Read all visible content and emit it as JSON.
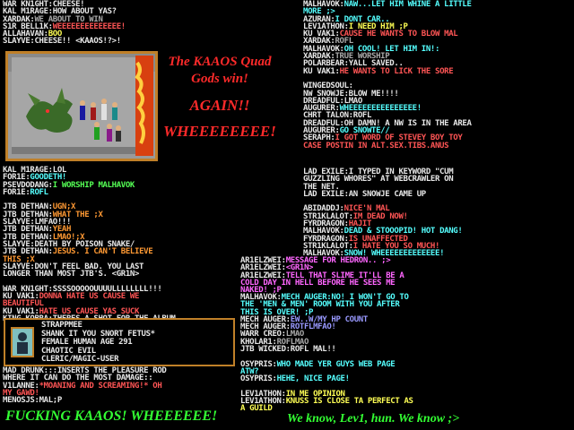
{
  "banner": {
    "line1": "The KAAOS Quad",
    "line2": "Gods win!",
    "line3": "AGAIN!!",
    "line4": "WHEEEEEEEE!"
  },
  "bottom_left": "FUCKING KAAOS! WHEEEEEE!",
  "bottom_right": "We know, Lev1, hun.  We know ;>",
  "left_top": [
    {
      "name": "WAR KN1GHT:",
      "text": "CHEESE!",
      "nc": "n",
      "tc": "n"
    },
    {
      "name": "KAL M1RAGE:",
      "text": "HOW ABOUT YAS?",
      "nc": "n",
      "tc": "n"
    },
    {
      "name": "XARDAK:",
      "text": "WE ABOUT TO WIN",
      "nc": "n",
      "tc": "k"
    },
    {
      "name": "S1R BELL1K:",
      "text": "WEEEEEEEEEEEEEE!",
      "nc": "n",
      "tc": "r"
    },
    {
      "name": "ALLAHAVAN:",
      "text": "BOO",
      "nc": "n",
      "tc": "y"
    },
    {
      "name": "SLAYVE:",
      "text": "CHEESE!!  <KAAOS!?>!",
      "nc": "n",
      "tc": "n"
    }
  ],
  "left_mid": [
    {
      "name": "KAL M1RAGE:",
      "text": "LOL",
      "nc": "n",
      "tc": "n"
    },
    {
      "name": "FOR1E:",
      "text": "GOODETH!",
      "nc": "n",
      "tc": "c"
    },
    {
      "name": "PSEVDODANG:",
      "text": "I WORSHIP MALHAVOK",
      "nc": "n",
      "tc": "g"
    },
    {
      "name": "FOR1E:",
      "text": "ROFL",
      "nc": "n",
      "tc": "c"
    },
    {
      "name": "",
      "text": "",
      "nc": "n",
      "tc": "n"
    },
    {
      "name": "JTB DETHAN:",
      "text": "UGN;X",
      "nc": "n",
      "tc": "o"
    },
    {
      "name": "JTB DETHAN:",
      "text": "WHAT THE ;X",
      "nc": "n",
      "tc": "o"
    },
    {
      "name": "SLAYVE:",
      "text": "LMFAO!!!",
      "nc": "n",
      "tc": "n"
    },
    {
      "name": "JTB DETHAN:",
      "text": "YEAH",
      "nc": "n",
      "tc": "o"
    },
    {
      "name": "JTB DETHAN:",
      "text": "LMAO!;X",
      "nc": "n",
      "tc": "o"
    },
    {
      "name": "SLAYVE:",
      "text": "DEATH BY POISON SNAKE/",
      "nc": "n",
      "tc": "n"
    },
    {
      "name": "JTB DETHAN:",
      "text": "JESUS. I CAN'T BELIEVE",
      "nc": "n",
      "tc": "o"
    },
    {
      "name": "",
      "text": "THIS ;X",
      "nc": "n",
      "tc": "o"
    },
    {
      "name": "SLAYVE:",
      "text": "DON'T FEEL BAD.  YOU LAST",
      "nc": "n",
      "tc": "n"
    },
    {
      "name": "",
      "text": "LONGER THAN MOST JTB'S.  <GR1N>",
      "nc": "n",
      "tc": "n"
    },
    {
      "name": "",
      "text": "",
      "nc": "n",
      "tc": "n"
    },
    {
      "name": "WAR KN1GHT:",
      "text": "SSSSOOOOOUUUULLLLLLLL!!!",
      "nc": "n",
      "tc": "n"
    },
    {
      "name": "KU VAK1:",
      "text": "DONNA HATE US CAUSE WE",
      "nc": "n",
      "tc": "r"
    },
    {
      "name": "",
      "text": "BEAUTIFUL",
      "nc": "n",
      "tc": "r"
    },
    {
      "name": "KU VAK1:",
      "text": "HATE US CAUSE YAS SUCK",
      "nc": "n",
      "tc": "r"
    },
    {
      "name": "KING KOBRA:",
      "text": "THERES A SHOT FOR THE ALBUM",
      "nc": "n",
      "tc": "n"
    }
  ],
  "char_card": [
    {
      "text": "STRAPPMEE",
      "c": "n"
    },
    {
      "text": "SHANK IT YOU SNORT FETUS*",
      "c": "n"
    },
    {
      "text": "FEMALE HUMAN AGE 291",
      "c": "n"
    },
    {
      "text": "CHAOTIC EVIL",
      "c": "n"
    },
    {
      "text": "CLERIC/MAGIC-USER",
      "c": "n"
    }
  ],
  "left_bottom": [
    {
      "name": "MAD DRUNK:",
      "text": "::INSERTS THE PLEASURE ROD",
      "nc": "n",
      "tc": "n"
    },
    {
      "name": "",
      "text": "WHERE IT CAN DO THE MOST DAMAGE::",
      "nc": "n",
      "tc": "n"
    },
    {
      "name": "V1LANNE:",
      "text": "*MOANING AND SCREAMING!*  OH",
      "nc": "n",
      "tc": "r"
    },
    {
      "name": "",
      "text": "MY GAWD!",
      "nc": "n",
      "tc": "r"
    },
    {
      "name": "MENOSJS:",
      "text": "MAL;P",
      "nc": "n",
      "tc": "n"
    }
  ],
  "right_top": [
    {
      "name": "MALHAVOK:",
      "text": "NAW...LET HIM WHINE A LITTLE",
      "nc": "n",
      "tc": "c"
    },
    {
      "name": "",
      "text": "MORE ;>",
      "nc": "n",
      "tc": "c"
    },
    {
      "name": "AZURAN:",
      "text": "I DONT CAR..",
      "nc": "n",
      "tc": "c"
    },
    {
      "name": "LEV1ATHON:",
      "text": "I NEED HIM ;P",
      "nc": "n",
      "tc": "y"
    },
    {
      "name": "KU VAK1:",
      "text": "CAUSE HE WANTS TO BLOW MAL",
      "nc": "n",
      "tc": "r"
    },
    {
      "name": "XARDAK:",
      "text": "ROFL",
      "nc": "n",
      "tc": "k"
    },
    {
      "name": "MALHAVOK:",
      "text": "OH COOL!  LET HIM IN!:",
      "nc": "n",
      "tc": "c"
    },
    {
      "name": "XARDAK:",
      "text": "TRUE WORSHIP",
      "nc": "n",
      "tc": "k"
    },
    {
      "name": "POLARBEAR:",
      "text": "YALL SAVED..",
      "nc": "n",
      "tc": "n"
    },
    {
      "name": "KU VAK1:",
      "text": "HE WANTS TO LICK THE SORE",
      "nc": "n",
      "tc": "r"
    },
    {
      "name": "",
      "text": "",
      "nc": "n",
      "tc": "n"
    },
    {
      "name": "WINGEDSOUL:",
      "text": "",
      "nc": "n",
      "tc": "n"
    },
    {
      "name": "",
      "text": "NW SNOWJE:BLOW ME!!!!",
      "nc": "n",
      "tc": "n"
    },
    {
      "name": "DREADFUL:",
      "text": "LMAO",
      "nc": "n",
      "tc": "n"
    },
    {
      "name": "AUGURER:",
      "text": "WHEEEEEEEEEEEEEEE!",
      "nc": "n",
      "tc": "c"
    },
    {
      "name": "CHRT TALON:",
      "text": "ROFL",
      "nc": "n",
      "tc": "n"
    },
    {
      "name": "DREADFUL:",
      "text": "OH DAMN! A NW IS IN THE AREA",
      "nc": "n",
      "tc": "n"
    },
    {
      "name": "AUGURER:",
      "text": "GO SNOWTE//",
      "nc": "n",
      "tc": "c"
    },
    {
      "name": "SERAPH:",
      "text": "I GOT WORD OF STEVEY BOY TOY",
      "nc": "n",
      "tc": "r"
    },
    {
      "name": "",
      "text": "CASE POSTIN IN ALT.SEX.TIBS.ANUS",
      "nc": "n",
      "tc": "r"
    }
  ],
  "right_mid": [
    {
      "name": "LAD EXILE:",
      "text": "I TYPED IN KEYWORD \"CUM",
      "nc": "n",
      "tc": "n"
    },
    {
      "name": "",
      "text": "GUZZLING WHORES\" AT WEBCRAWLER ON",
      "nc": "n",
      "tc": "n"
    },
    {
      "name": "",
      "text": "THE NET.",
      "nc": "n",
      "tc": "n"
    },
    {
      "name": "LAD EXILE:",
      "text": "AN SNOWJE CAME UP",
      "nc": "n",
      "tc": "n"
    },
    {
      "name": "",
      "text": "",
      "nc": "n",
      "tc": "n"
    },
    {
      "name": "ABIDADDJ:",
      "text": "NICE'N MAL",
      "nc": "n",
      "tc": "r"
    },
    {
      "name": "STR1KLALOT:",
      "text": "IM DEAD NOW!",
      "nc": "n",
      "tc": "r"
    },
    {
      "name": "FYRDRAGON:",
      "text": "HAJIT",
      "nc": "n",
      "tc": "r"
    },
    {
      "name": "MALHAVOK:",
      "text": "DEAD & STOOOPID! HOT DANG!",
      "nc": "n",
      "tc": "c"
    },
    {
      "name": "FYRDRAGON:",
      "text": "IS UNAFFECTED",
      "nc": "n",
      "tc": "r"
    },
    {
      "name": "STR1KLALOT:",
      "text": "I HATE YOU SO MUCH!",
      "nc": "n",
      "tc": "r"
    },
    {
      "name": "MALHAVOK:",
      "text": "SNOW! WHEEEEEEEEEEEEE!",
      "nc": "n",
      "tc": "c"
    }
  ],
  "right_mid2": [
    {
      "name": "AR1ELZWEI:",
      "text": "MESSAGE FOR HEDRON.. ;>",
      "nc": "n",
      "tc": "p"
    },
    {
      "name": "AR1ELZWEI:",
      "text": "<GR1N>",
      "nc": "n",
      "tc": "p"
    },
    {
      "name": "AR1ELZWEI:",
      "text": "TELL THAT SLIME IT'LL BE A",
      "nc": "n",
      "tc": "p"
    },
    {
      "name": "",
      "text": "COLD DAY IN HELL BEFORE HE SEES ME",
      "nc": "n",
      "tc": "p"
    },
    {
      "name": "",
      "text": "NAKED! ;P",
      "nc": "n",
      "tc": "p"
    }
  ],
  "right_low": [
    {
      "name": "MALHAVOK:",
      "text": "MECH AUGER:NO!  I WON'T GO TO",
      "nc": "n",
      "tc": "c"
    },
    {
      "name": "",
      "text": "THE 'MEN & MEN' ROOM WITH YOU AFTER",
      "nc": "n",
      "tc": "c"
    },
    {
      "name": "",
      "text": "THIS IS OVER! ;P",
      "nc": "n",
      "tc": "c"
    },
    {
      "name": "MECH AUGER:",
      "text": "EW..W/MY HP COUNT",
      "nc": "n",
      "tc": "b"
    },
    {
      "name": "MECH AUGER:",
      "text": "ROTFLMFAO!",
      "nc": "n",
      "tc": "b"
    },
    {
      "name": "WARR CREO:",
      "text": "LMAO",
      "nc": "n",
      "tc": "k"
    },
    {
      "name": "KHOLAR1:",
      "text": "ROFLMAO",
      "nc": "n",
      "tc": "k"
    },
    {
      "name": "JTB WICKED:",
      "text": "ROFL MAL!!",
      "nc": "n",
      "tc": "n"
    },
    {
      "name": "",
      "text": "",
      "nc": "n",
      "tc": "n"
    },
    {
      "name": "OSYPRIS:",
      "text": "WHO MADE YER GUYS WEB PAGE",
      "nc": "n",
      "tc": "c"
    },
    {
      "name": "",
      "text": "ATW?",
      "nc": "n",
      "tc": "c"
    },
    {
      "name": "OSYPRIS:",
      "text": "HEHE, NICE PAGE!",
      "nc": "n",
      "tc": "c"
    },
    {
      "name": "",
      "text": "",
      "nc": "n",
      "tc": "n"
    },
    {
      "name": "LEV1ATHON:",
      "text": "IN ME OPINION",
      "nc": "n",
      "tc": "y"
    },
    {
      "name": "LEV1ATHON:",
      "text": "KNUSS IS CLOSE TA PERFECT AS",
      "nc": "n",
      "tc": "y"
    },
    {
      "name": "",
      "text": "A GUILD",
      "nc": "n",
      "tc": "y"
    }
  ]
}
